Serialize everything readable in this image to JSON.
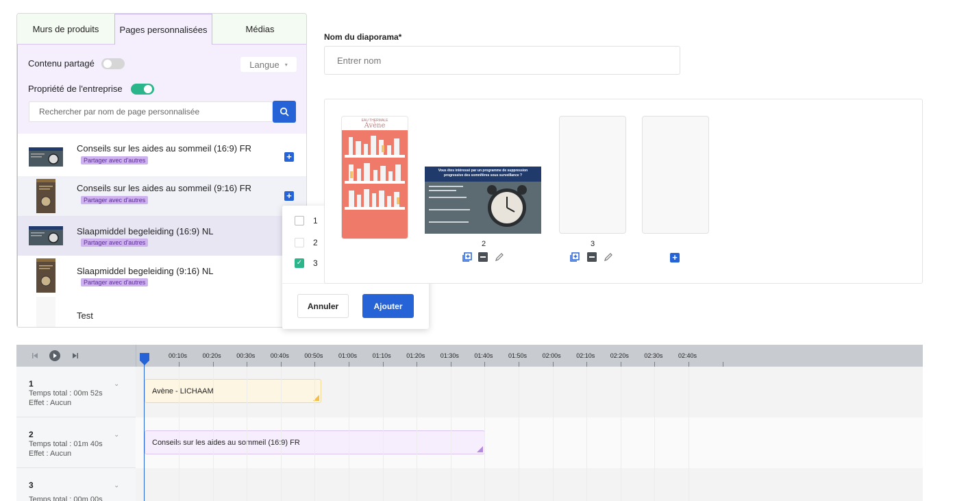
{
  "tabs": [
    "Murs de produits",
    "Pages personnalisées",
    "Médias"
  ],
  "filters": {
    "shared_label": "Contenu partagé",
    "shared_on": false,
    "company_label": "Propriété de l'entreprise",
    "company_on": true,
    "language_label": "Langue",
    "search_placeholder": "Rechercher par nom de page personnalisée"
  },
  "pages": [
    {
      "title": "Conseils sur les aides au sommeil (16:9) FR",
      "badge": "Partager avec d'autres"
    },
    {
      "title": "Conseils sur les aides au sommeil (9:16) FR",
      "badge": "Partager avec d'autres"
    },
    {
      "title": "Slaapmiddel begeleiding (16:9) NL",
      "badge": "Partager avec d'autres"
    },
    {
      "title": "Slaapmiddel begeleiding (9:16) NL",
      "badge": "Partager avec d'autres"
    },
    {
      "title": "Test"
    }
  ],
  "popup": {
    "options": [
      {
        "label": "1",
        "checked": false
      },
      {
        "label": "2",
        "checked": false
      },
      {
        "label": "3",
        "checked": true
      }
    ],
    "cancel_label": "Annuler",
    "add_label": "Ajouter"
  },
  "slideshow": {
    "name_label": "Nom du diaporama*",
    "name_placeholder": "Entrer nom",
    "slot_numbers": [
      "2",
      "3"
    ],
    "avene_brand_top": "EAU THERMALE",
    "avene_brand": "Avène",
    "slide2_text": "Vous êtes intéressé par un programme de suppression progressive des somnifères sous surveillance ?"
  },
  "timeline": {
    "ticks": [
      "00:10s",
      "00:20s",
      "00:30s",
      "00:40s",
      "00:50s",
      "01:00s",
      "01:10s",
      "01:20s",
      "01:30s",
      "01:40s",
      "01:50s",
      "02:00s",
      "02:10s",
      "02:20s",
      "02:30s",
      "02:40s"
    ],
    "tracks": [
      {
        "num": "1",
        "total": "Temps total : 00m 52s",
        "effect": "Effet : Aucun",
        "clip": "Avène - LICHAAM"
      },
      {
        "num": "2",
        "total": "Temps total : 01m 40s",
        "effect": "Effet : Aucun",
        "clip": "Conseils sur les aides au sommeil (16:9) FR"
      },
      {
        "num": "3",
        "total": "Temps total : 00m 00s",
        "effect": "",
        "clip": ""
      }
    ]
  },
  "colors": {
    "accent": "#2563d6",
    "toggle_on": "#2bb58a",
    "badge": "#cdb2ee",
    "panel_tint": "#f4eefd"
  }
}
